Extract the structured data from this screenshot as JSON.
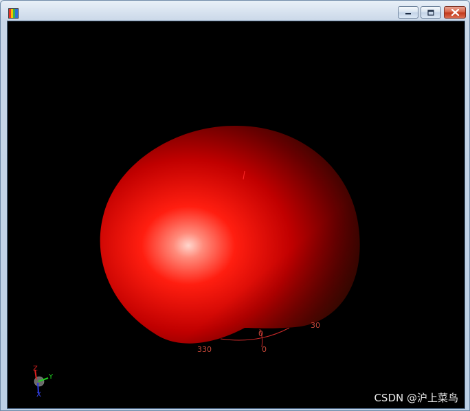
{
  "window": {
    "icon": "rainbow-app-icon",
    "buttons": [
      "minimize-icon",
      "maximize-icon",
      "close-icon"
    ]
  },
  "scene": {
    "tick_labels": {
      "left": "330",
      "bottom": "0",
      "right": "30",
      "center": "0"
    },
    "axes": {
      "z": "Z",
      "y": "Y",
      "x": "X"
    },
    "colors": {
      "surface": "#ff1a1a",
      "highlight": "#ffd0c8",
      "grid": "#cc2a2a",
      "background": "#000000"
    }
  },
  "watermark": "CSDN @沪上菜鸟"
}
